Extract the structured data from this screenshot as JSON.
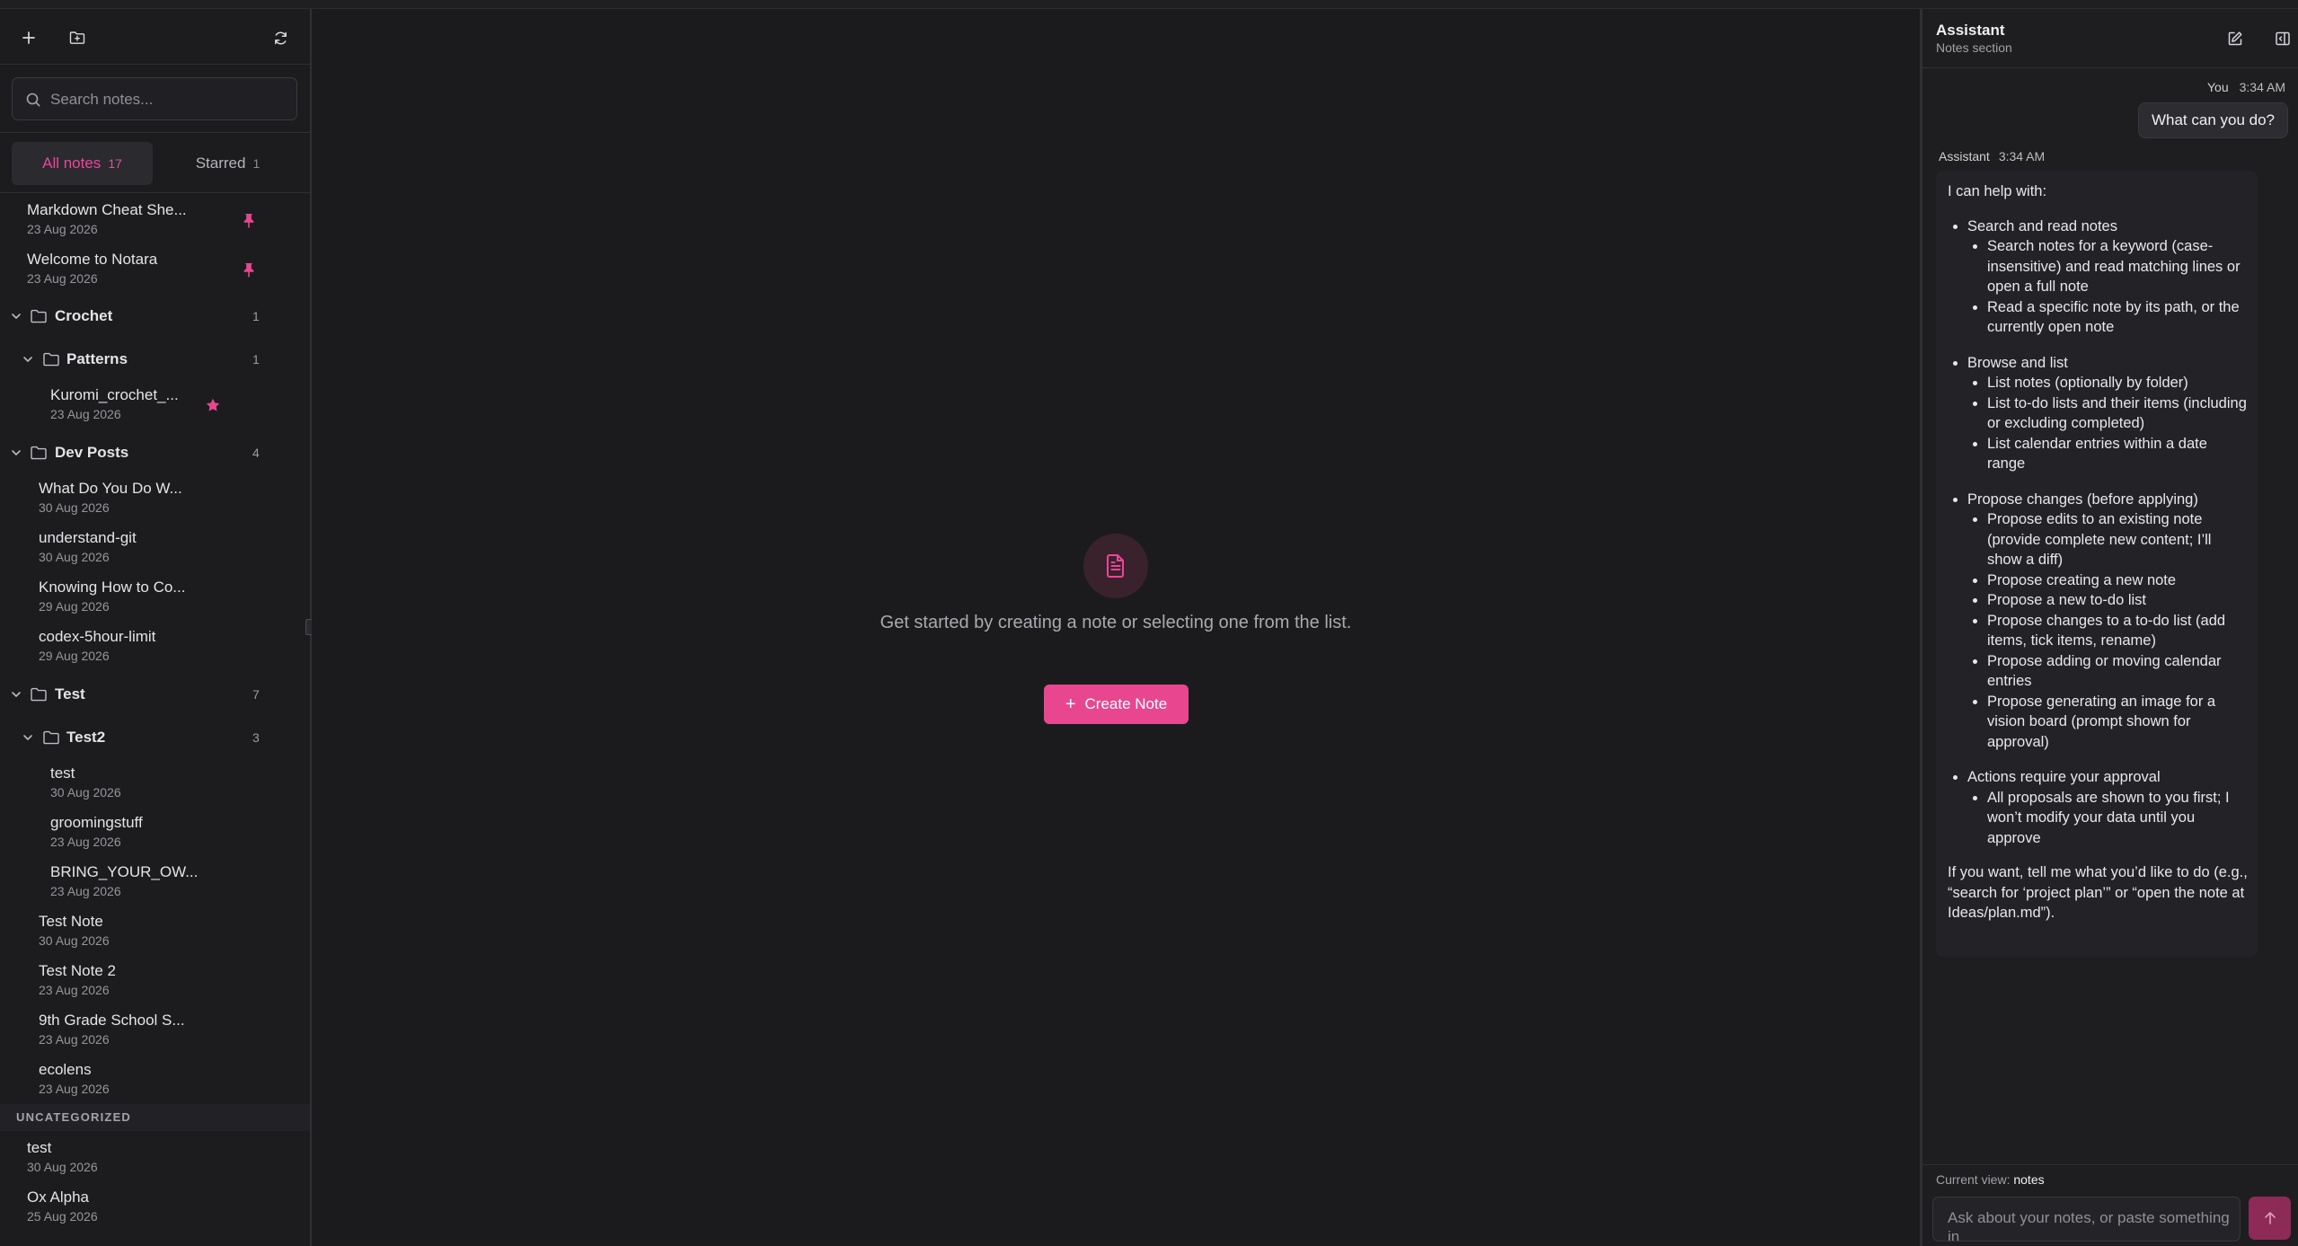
{
  "colors": {
    "accent": "#e8478f",
    "background": "#1b1b1d",
    "sidebar": "#1c1c1f"
  },
  "sidebar": {
    "search_placeholder": "Search notes...",
    "tabs": [
      {
        "label": "All notes",
        "count": "17"
      },
      {
        "label": "Starred",
        "count": "1"
      }
    ],
    "pinned": [
      {
        "title": "Markdown Cheat She...",
        "date": "23 Aug 2026"
      },
      {
        "title": "Welcome to Notara",
        "date": "23 Aug 2026"
      }
    ],
    "folders": {
      "crochet": {
        "name": "Crochet",
        "count": "1"
      },
      "patterns": {
        "name": "Patterns",
        "count": "1"
      },
      "devposts": {
        "name": "Dev Posts",
        "count": "4"
      },
      "test": {
        "name": "Test",
        "count": "7"
      },
      "test2": {
        "name": "Test2",
        "count": "3"
      }
    },
    "patterns_notes": [
      {
        "title": "Kuromi_crochet_...",
        "date": "23 Aug 2026"
      }
    ],
    "devposts_notes": [
      {
        "title": "What Do You Do W...",
        "date": "30 Aug 2026"
      },
      {
        "title": "understand-git",
        "date": "30 Aug 2026"
      },
      {
        "title": "Knowing How to Co...",
        "date": "29 Aug 2026"
      },
      {
        "title": "codex-5hour-limit",
        "date": "29 Aug 2026"
      }
    ],
    "test2_notes": [
      {
        "title": "test",
        "date": "30 Aug 2026"
      },
      {
        "title": "groomingstuff",
        "date": "23 Aug 2026"
      },
      {
        "title": "BRING_YOUR_OW...",
        "date": "23 Aug 2026"
      }
    ],
    "test_notes": [
      {
        "title": "Test Note",
        "date": "30 Aug 2026"
      },
      {
        "title": "Test Note 2",
        "date": "23 Aug 2026"
      },
      {
        "title": "9th Grade School S...",
        "date": "23 Aug 2026"
      },
      {
        "title": "ecolens",
        "date": "23 Aug 2026"
      }
    ],
    "uncategorized_label": "UNCATEGORIZED",
    "uncategorized_notes": [
      {
        "title": "test",
        "date": "30 Aug 2026"
      },
      {
        "title": "Ox Alpha",
        "date": "25 Aug 2026"
      }
    ]
  },
  "main": {
    "empty_text": "Get started by creating a note or selecting one from the list.",
    "create_label": "Create Note"
  },
  "assistant": {
    "title": "Assistant",
    "subtitle": "Notes section",
    "user_name": "You",
    "user_time": "3:34 AM",
    "user_message": "What can you do?",
    "assistant_name": "Assistant",
    "assistant_time": "3:34 AM",
    "intro": "I can help with:",
    "sections": [
      {
        "heading": "Search and read notes",
        "items": [
          "Search notes for a keyword (case-insensitive) and read matching lines or open a full note",
          "Read a specific note by its path, or the currently open note"
        ]
      },
      {
        "heading": "Browse and list",
        "items": [
          "List notes (optionally by folder)",
          "List to-do lists and their items (including or excluding completed)",
          "List calendar entries within a date range"
        ]
      },
      {
        "heading": "Propose changes (before applying)",
        "items": [
          "Propose edits to an existing note (provide complete new content; I’ll show a diff)",
          "Propose creating a new note",
          "Propose a new to-do list",
          "Propose changes to a to-do list (add items, tick items, rename)",
          "Propose adding or moving calendar entries",
          "Propose generating an image for a vision board (prompt shown for approval)"
        ]
      },
      {
        "heading": "Actions require your approval",
        "items": [
          "All proposals are shown to you first; I won’t modify your data until you approve"
        ]
      }
    ],
    "followup": "If you want, tell me what you’d like to do (e.g., “search for ‘project plan’” or “open the note at Ideas/plan.md”).",
    "current_view_label": "Current view:",
    "current_view_value": "notes",
    "composer_placeholder": "Ask about your notes, or paste something in"
  }
}
